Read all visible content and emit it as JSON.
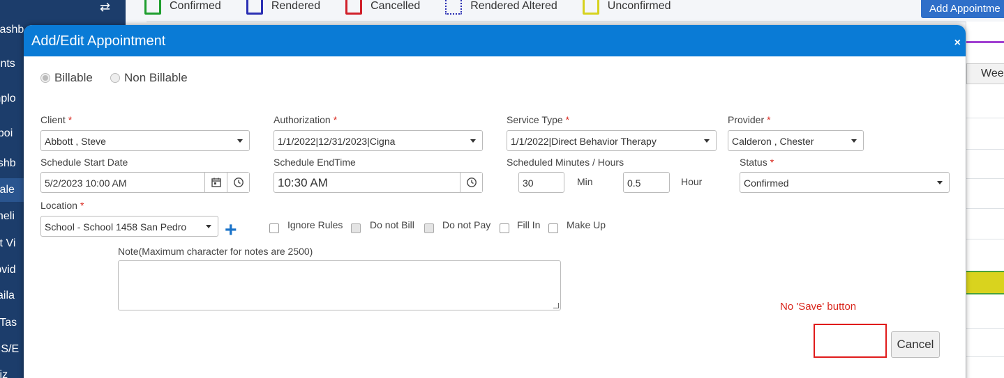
{
  "background": {
    "sidebar_items": [
      "Dashb",
      "ients",
      "mplo",
      "ppoi",
      "ashb",
      "Cale",
      "imeli",
      "ist Vi",
      "rovid",
      "vaila",
      "ll Tas",
      "MS/E",
      "tiliz"
    ],
    "legend": [
      {
        "label": "Confirmed",
        "color": "#1e9e2e",
        "style": "solid"
      },
      {
        "label": "Rendered",
        "color": "#2a2fb3",
        "style": "solid"
      },
      {
        "label": "Cancelled",
        "color": "#d0202a",
        "style": "solid"
      },
      {
        "label": "Rendered Altered",
        "color": "#2a2fb3",
        "style": "dotted"
      },
      {
        "label": "Unconfirmed",
        "color": "#d6d21e",
        "style": "solid"
      }
    ],
    "add_appointment_label": "Add Appointme",
    "week_label": "Wee"
  },
  "modal": {
    "title": "Add/Edit Appointment",
    "close_label": "×",
    "billing": {
      "billable_label": "Billable",
      "non_billable_label": "Non Billable",
      "selected": "billable"
    },
    "client": {
      "label": "Client",
      "value": "Abbott , Steve"
    },
    "authorization": {
      "label": "Authorization",
      "value": "1/1/2022|12/31/2023|Cigna"
    },
    "service_type": {
      "label": "Service Type",
      "value": "1/1/2022|Direct Behavior Therapy"
    },
    "provider": {
      "label": "Provider",
      "value": "Calderon , Chester"
    },
    "schedule_start": {
      "label": "Schedule Start Date",
      "value": "5/2/2023 10:00 AM"
    },
    "schedule_end": {
      "label": "Schedule EndTime",
      "value": "10:30 AM"
    },
    "scheduled_minutes_hours": {
      "label": "Scheduled Minutes / Hours",
      "minutes_value": "30",
      "minutes_unit": "Min",
      "hours_value": "0.5",
      "hours_unit": "Hour"
    },
    "status": {
      "label": "Status",
      "value": "Confirmed"
    },
    "location": {
      "label": "Location",
      "value": "School - School 1458 San Pedro"
    },
    "checkboxes": {
      "ignore_rules": "Ignore Rules",
      "do_not_bill": "Do not Bill",
      "do_not_pay": "Do not Pay",
      "fill_in": "Fill In",
      "make_up": "Make Up"
    },
    "note": {
      "label": "Note(Maximum character for notes are 2500)",
      "value": ""
    },
    "annotation": "No 'Save' button",
    "cancel_label": "Cancel",
    "required_marker": "*"
  },
  "colors": {
    "header_blue": "#0a7bd6",
    "required_red": "#d9261c",
    "annotation_red": "#e01b1b",
    "plus_blue": "#1a73c9"
  }
}
